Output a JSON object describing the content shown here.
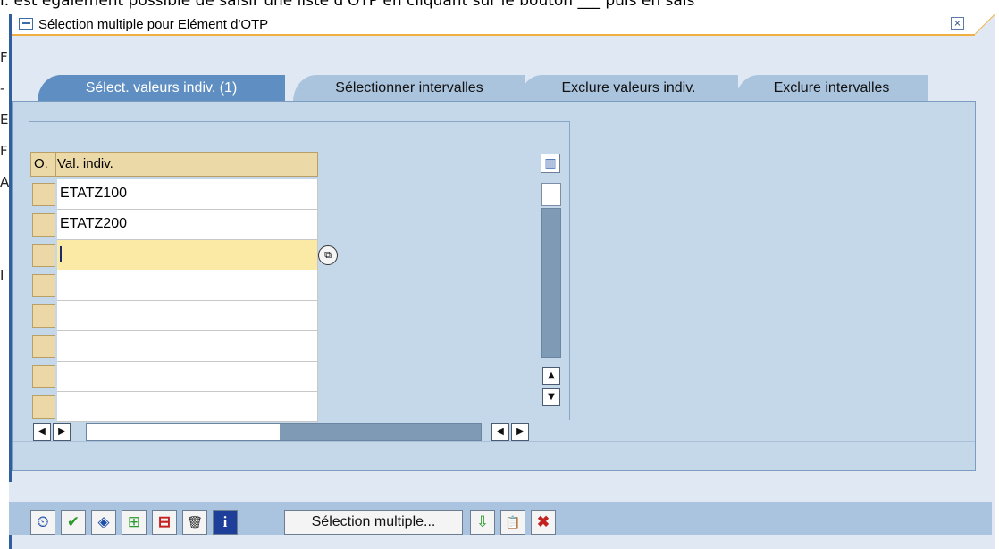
{
  "doc_text": "l. est également possible de saisir une liste d'OTP en cliquant sur le bouton ___ puis en sais",
  "left_edge_letters": [
    "F",
    "-",
    "E",
    "F",
    "A",
    "I"
  ],
  "dialog": {
    "title": "Sélection multiple pour Elément d'OTP",
    "close_glyph": "×"
  },
  "tabs": [
    {
      "label": "Sélect. valeurs indiv. (1)",
      "active": true
    },
    {
      "label": "Sélectionner intervalles",
      "active": false
    },
    {
      "label": "Exclure valeurs indiv.",
      "active": false
    },
    {
      "label": "Exclure intervalles",
      "active": false
    }
  ],
  "table": {
    "col_sel_header": "O.",
    "col_val_header": "Val. indiv.",
    "rows": [
      "ETATZ100",
      "ETATZ200",
      "",
      "",
      "",
      "",
      "",
      ""
    ],
    "active_row": 2,
    "help_glyph": "⧉"
  },
  "scroll": {
    "up": "▲",
    "down": "▼",
    "left": "◀",
    "right": "▶",
    "col_config": "▥"
  },
  "footer": {
    "buttons": [
      {
        "name": "execute-icon",
        "glyph": "⏲"
      },
      {
        "name": "check-icon",
        "glyph": "✔"
      },
      {
        "name": "variant-icon",
        "glyph": "◈"
      },
      {
        "name": "insert-row-icon",
        "glyph": "⊞"
      },
      {
        "name": "delete-row-icon",
        "glyph": "⊟"
      },
      {
        "name": "trash-icon",
        "glyph": "🗑"
      },
      {
        "name": "info-icon",
        "glyph": "i"
      }
    ],
    "multiple_selection_label": "Sélection multiple...",
    "after_buttons": [
      {
        "name": "import-icon",
        "glyph": "⇩"
      },
      {
        "name": "clipboard-icon",
        "glyph": "📋"
      },
      {
        "name": "cancel-icon",
        "glyph": "✖"
      }
    ]
  }
}
